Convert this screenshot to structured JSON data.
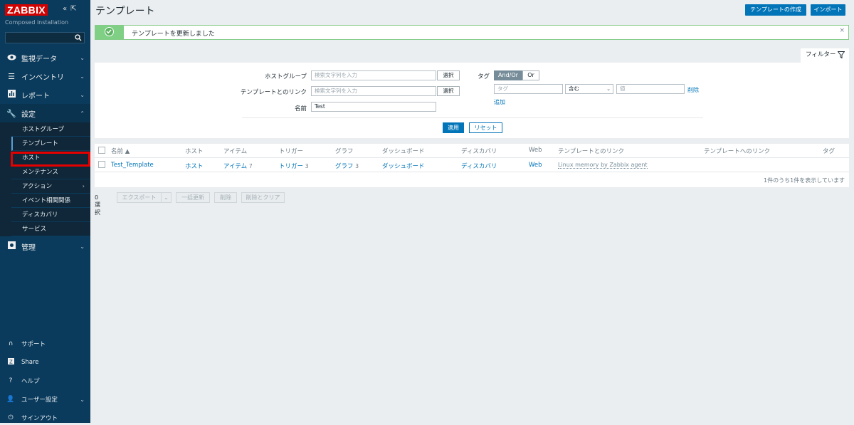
{
  "sidebar": {
    "logo": "ZABBIX",
    "subtitle": "Composed installation",
    "search_placeholder": "",
    "menu": [
      {
        "label": "監視データ",
        "icon": "eye-icon"
      },
      {
        "label": "インベントリ",
        "icon": "list-icon"
      },
      {
        "label": "レポート",
        "icon": "report-icon"
      },
      {
        "label": "設定",
        "icon": "wrench-icon"
      },
      {
        "label": "管理",
        "icon": "admin-icon"
      }
    ],
    "submenu": [
      "ホストグループ",
      "テンプレート",
      "ホスト",
      "メンテナンス",
      "アクション",
      "イベント相関関係",
      "ディスカバリ",
      "サービス"
    ],
    "bottom": [
      {
        "label": "サポート",
        "icon": "headset-icon"
      },
      {
        "label": "Share",
        "icon": "share-icon"
      },
      {
        "label": "ヘルプ",
        "icon": "help-icon"
      },
      {
        "label": "ユーザー設定",
        "icon": "user-icon"
      },
      {
        "label": "サインアウト",
        "icon": "power-icon"
      }
    ]
  },
  "header": {
    "title": "テンプレート",
    "create_button": "テンプレートの作成",
    "import_button": "インポート"
  },
  "message": {
    "text": "テンプレートを更新しました",
    "close": "×"
  },
  "filter": {
    "tab_label": "フィルター",
    "host_group_label": "ホストグループ",
    "host_group_placeholder": "検索文字列を入力",
    "linked_templates_label": "テンプレートとのリンク",
    "linked_templates_placeholder": "検索文字列を入力",
    "name_label": "名前",
    "name_value": "Test",
    "select_button": "選択",
    "tags_label": "タグ",
    "and_or": "And/Or",
    "or": "Or",
    "tag_placeholder": "タグ",
    "operator": "含む",
    "value_placeholder": "値",
    "remove": "削除",
    "add": "追加",
    "apply": "適用",
    "reset": "リセット"
  },
  "table": {
    "headers": [
      "名前 ▲",
      "ホスト",
      "アイテム",
      "トリガー",
      "グラフ",
      "ダッシュボード",
      "ディスカバリ",
      "Web",
      "テンプレートとのリンク",
      "テンプレートへのリンク",
      "タグ"
    ],
    "row": {
      "name": "Test_Template",
      "hosts": "ホスト",
      "items": "アイテム",
      "items_count": "7",
      "triggers": "トリガー",
      "triggers_count": "3",
      "graphs": "グラフ",
      "graphs_count": "3",
      "dashboards": "ダッシュボード",
      "discovery": "ディスカバリ",
      "web": "Web",
      "linked": "Linux memory by Zabbix agent"
    },
    "footer": "1件のうち1件を表示しています"
  },
  "actions": {
    "selected": "0 選択",
    "export": "エクスポート",
    "mass_update": "一括更新",
    "delete": "削除",
    "delete_clear": "削除とクリア"
  }
}
